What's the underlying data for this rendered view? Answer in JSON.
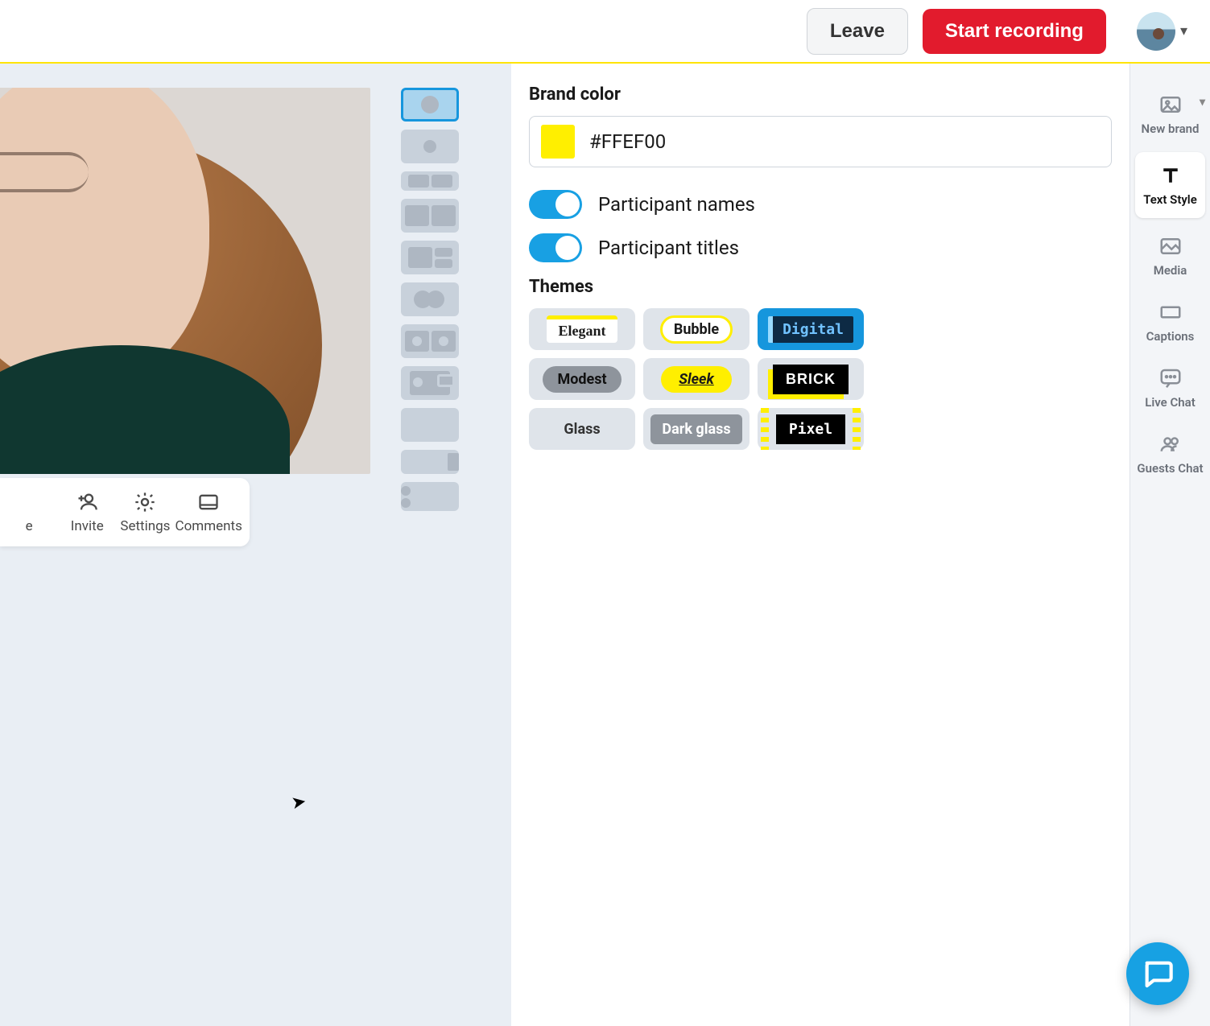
{
  "header": {
    "leave_label": "Leave",
    "record_label": "Start recording"
  },
  "callbar": {
    "truncated_label": "e",
    "invite": "Invite",
    "settings": "Settings",
    "comments": "Comments"
  },
  "panel": {
    "brand_color_title": "Brand color",
    "brand_color_value": "#FFEF00",
    "toggle_names_label": "Participant names",
    "toggle_titles_label": "Participant titles",
    "themes_title": "Themes",
    "themes": {
      "elegant": "Elegant",
      "bubble": "Bubble",
      "digital": "Digital",
      "modest": "Modest",
      "sleek": "Sleek",
      "brick": "BRICK",
      "glass": "Glass",
      "dark_glass": "Dark glass",
      "pixel": "Pixel"
    }
  },
  "sidebar": {
    "new_brand": "New brand",
    "text_style": "Text Style",
    "media": "Media",
    "captions": "Captions",
    "live_chat": "Live Chat",
    "guests_chat": "Guests Chat"
  },
  "colors": {
    "accent": "#FFEF00",
    "primary_blue": "#18a0e3",
    "record_red": "#e21b2d"
  }
}
